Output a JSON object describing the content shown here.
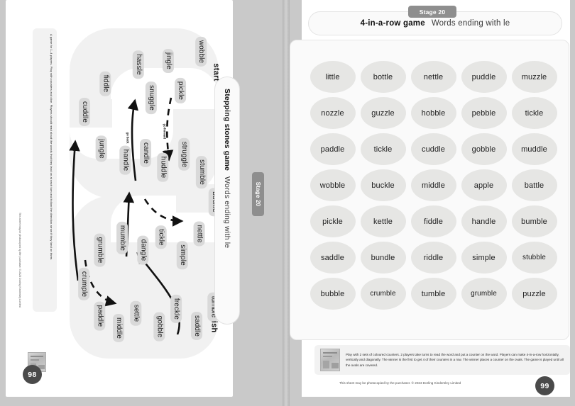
{
  "spread": {
    "left_page_number": "98",
    "right_page_number": "99",
    "copyright": "This sheet may be photocopied by the purchaser. © 2023 Dorling Kindersley Limited"
  },
  "left_page": {
    "instructions": "A game for 1–4 players. Play with counters and dice. Players should read aloud the words that they land on at each turn and follow the direction arrow if they land on them.",
    "side_tab": {
      "stage_label": "Stage 20",
      "title_bold": "Stepping stones game",
      "title_regular": "Words ending with le"
    },
    "board": {
      "start_label": "start",
      "finish_label": "finish",
      "arrow_back_label": "go back",
      "arrow_forward_label": "go forward",
      "words": [
        "wobble",
        "jingle",
        "pickle",
        "hassle",
        "snuggle",
        "fiddle",
        "cuddle",
        "jungle",
        "handle",
        "candle",
        "huddle",
        "struggle",
        "stumble",
        "buckle",
        "nettle",
        "tickle",
        "simple",
        "dangle",
        "mumble",
        "grumble",
        "crumple",
        "paddle",
        "middle",
        "settle",
        "gobble",
        "freckle",
        "saddle",
        "tumble"
      ]
    }
  },
  "right_page": {
    "stage_label": "Stage 20",
    "title_bold": "4-in-a-row game",
    "title_regular": "Words ending with le",
    "grid": {
      "rows": [
        [
          "little",
          "bottle",
          "nettle",
          "puddle",
          "muzzle"
        ],
        [
          "nozzle",
          "guzzle",
          "hobble",
          "pebble",
          "tickle"
        ],
        [
          "paddle",
          "tickle",
          "cuddle",
          "gobble",
          "muddle"
        ],
        [
          "wobble",
          "buckle",
          "middle",
          "apple",
          "battle"
        ],
        [
          "pickle",
          "kettle",
          "fiddle",
          "handle",
          "bumble"
        ],
        [
          "saddle",
          "bundle",
          "riddle",
          "simple",
          "stubble"
        ],
        [
          "bubble",
          "crumble",
          "tumble",
          "grumble",
          "puzzle"
        ]
      ]
    },
    "instructions": "Play with 2 sets of coloured counters. 2 players take turns to read the word and put a counter on the word. Players can make 4-in-a-row horizontally, vertically and diagonally. The winner is the first to get 4 of their counters in a row. The winner places a counter on the ovals. The game is played until all the ovals are covered."
  },
  "colors": {
    "background": "#c9c9c9",
    "paper": "#ffffff",
    "pill": "#8e8e8e",
    "oval": "#e6e6e4",
    "word_chip": "#d9d9d9",
    "page_badge": "#4a4a4a"
  }
}
